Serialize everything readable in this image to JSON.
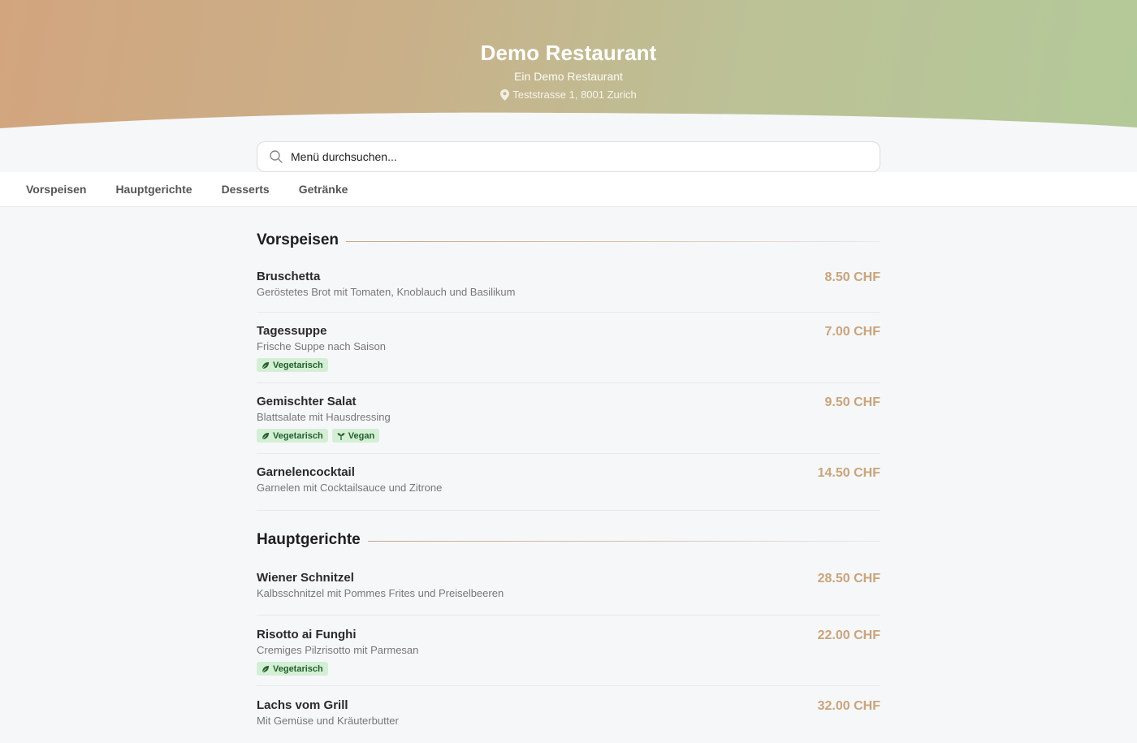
{
  "header": {
    "title": "Demo Restaurant",
    "subtitle": "Ein Demo Restaurant",
    "address": "Teststrasse 1, 8001 Zurich"
  },
  "search": {
    "placeholder": "Menü durchsuchen..."
  },
  "tabs": [
    "Vorspeisen",
    "Hauptgerichte",
    "Desserts",
    "Getränke"
  ],
  "badge_labels": {
    "vegetarian": "Vegetarisch",
    "vegan": "Vegan"
  },
  "sections": [
    {
      "title": "Vorspeisen",
      "items": [
        {
          "name": "Bruschetta",
          "desc": "Geröstetes Brot mit Tomaten, Knoblauch und Basilikum",
          "price": "8.50 CHF",
          "badges": []
        },
        {
          "name": "Tagessuppe",
          "desc": "Frische Suppe nach Saison",
          "price": "7.00 CHF",
          "badges": [
            "vegetarian"
          ]
        },
        {
          "name": "Gemischter Salat",
          "desc": "Blattsalate mit Hausdressing",
          "price": "9.50 CHF",
          "badges": [
            "vegetarian",
            "vegan"
          ]
        },
        {
          "name": "Garnelencocktail",
          "desc": "Garnelen mit Cocktailsauce und Zitrone",
          "price": "14.50 CHF",
          "badges": []
        }
      ]
    },
    {
      "title": "Hauptgerichte",
      "items": [
        {
          "name": "Wiener Schnitzel",
          "desc": "Kalbsschnitzel mit Pommes Frites und Preiselbeeren",
          "price": "28.50 CHF",
          "badges": []
        },
        {
          "name": "Risotto ai Funghi",
          "desc": "Cremiges Pilzrisotto mit Parmesan",
          "price": "22.00 CHF",
          "badges": [
            "vegetarian"
          ]
        },
        {
          "name": "Lachs vom Grill",
          "desc": "Mit Gemüse und Kräuterbutter",
          "price": "32.00 CHF",
          "badges": []
        }
      ]
    }
  ],
  "colors": {
    "accent_price": "#c9a47c",
    "badge_bg": "#d4efd6",
    "badge_text": "#22602b",
    "hero_gradient_start": "#d2a57e",
    "hero_gradient_end": "#b3c998"
  },
  "icons": {
    "address": "map-pin-icon",
    "search": "search-icon",
    "vegetarian": "leaf-icon",
    "vegan": "sprout-icon"
  }
}
